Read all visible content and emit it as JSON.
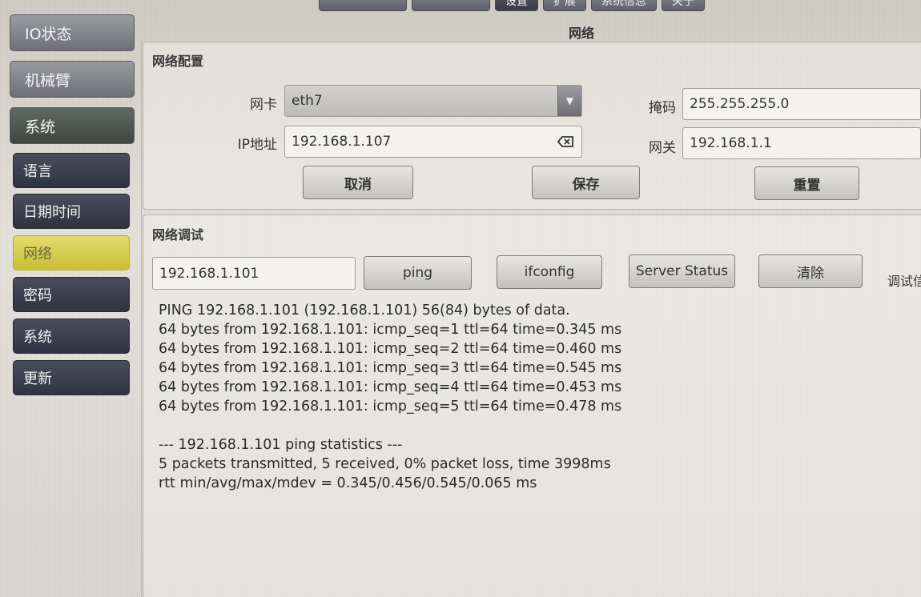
{
  "top_tabs": [
    "",
    "",
    "设置",
    "扩展",
    "系统信息",
    "关于"
  ],
  "sidebar": {
    "main_items": [
      {
        "label": "IO状态"
      },
      {
        "label": "机械臂"
      },
      {
        "label": "系统"
      }
    ],
    "sub_items": [
      {
        "label": "语言"
      },
      {
        "label": "日期时间"
      },
      {
        "label": "网络",
        "active": true
      },
      {
        "label": "密码"
      },
      {
        "label": "系统"
      },
      {
        "label": "更新"
      }
    ]
  },
  "page": {
    "title": "网络"
  },
  "network_config": {
    "title": "网络配置",
    "nic_label": "网卡",
    "nic_value": "eth7",
    "ip_label": "IP地址",
    "ip_value": "192.168.1.107",
    "mask_label": "掩码",
    "mask_value": "255.255.255.0",
    "gateway_label": "网关",
    "gateway_value": "192.168.1.1",
    "cancel_label": "取消",
    "save_label": "保存",
    "reset_label": "重置"
  },
  "network_debug": {
    "title": "网络调试",
    "target_value": "192.168.1.101",
    "ping_label": "ping",
    "ifconfig_label": "ifconfig",
    "server_status_label": "Server Status",
    "clear_label": "清除",
    "debug_label": "调试信",
    "output_lines": [
      "PING 192.168.1.101 (192.168.1.101) 56(84) bytes of data.",
      "64 bytes from 192.168.1.101: icmp_seq=1 ttl=64 time=0.345 ms",
      "64 bytes from 192.168.1.101: icmp_seq=2 ttl=64 time=0.460 ms",
      "64 bytes from 192.168.1.101: icmp_seq=3 ttl=64 time=0.545 ms",
      "64 bytes from 192.168.1.101: icmp_seq=4 ttl=64 time=0.453 ms",
      "64 bytes from 192.168.1.101: icmp_seq=5 ttl=64 time=0.478 ms",
      "",
      "--- 192.168.1.101 ping statistics ---",
      "5 packets transmitted, 5 received, 0% packet loss, time 3998ms",
      "rtt min/avg/max/mdev = 0.345/0.456/0.545/0.065 ms"
    ]
  },
  "colors": {
    "active_nav": "#d6ce4a",
    "sub_nav": "#3a3e4c",
    "main_nav": "#84858c"
  }
}
